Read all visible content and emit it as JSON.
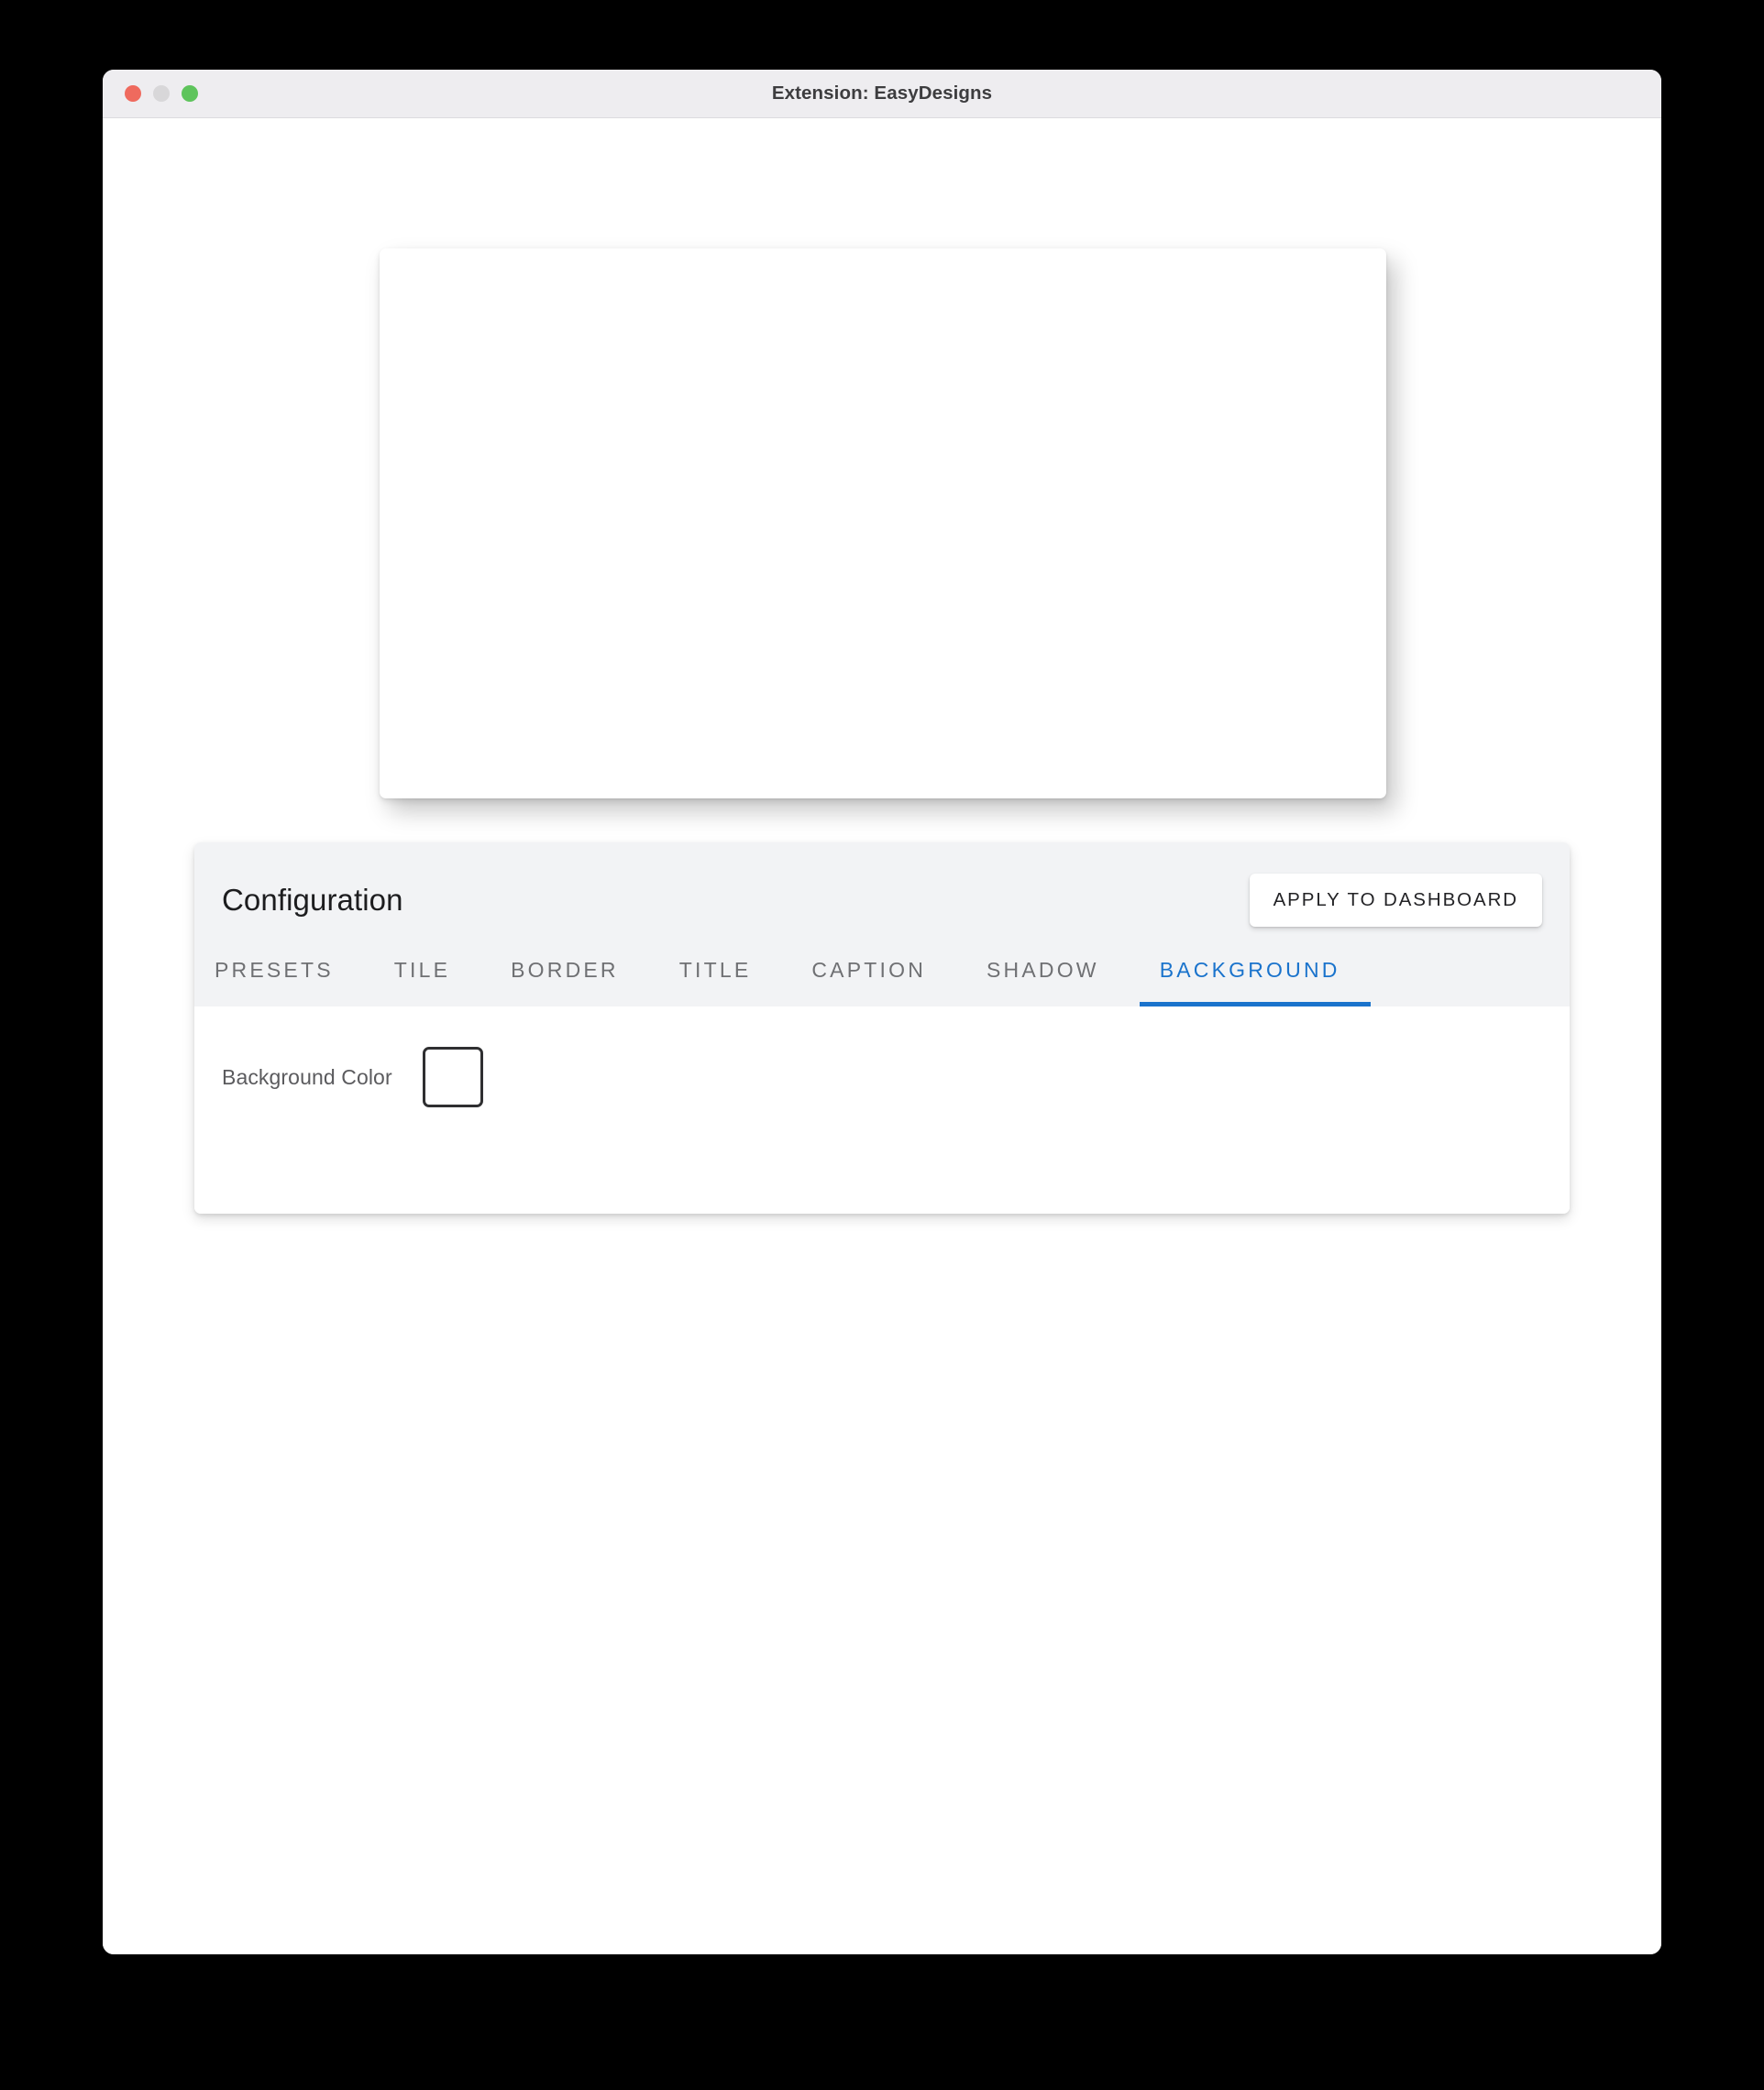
{
  "window": {
    "title": "Extension: EasyDesigns",
    "traffic_lights": [
      {
        "name": "close",
        "color": "#ef6a5e"
      },
      {
        "name": "minimize",
        "color": "#d8d7d9"
      },
      {
        "name": "zoom",
        "color": "#5ec45c"
      }
    ]
  },
  "preview": {
    "background_color": "#ffffff"
  },
  "configuration": {
    "title": "Configuration",
    "apply_button_label": "APPLY TO DASHBOARD",
    "active_tab": "BACKGROUND",
    "accent_color": "#1a73cc",
    "tabs": [
      {
        "label": "PRESETS",
        "active": false
      },
      {
        "label": "TILE",
        "active": false
      },
      {
        "label": "BORDER",
        "active": false
      },
      {
        "label": "TITLE",
        "active": false
      },
      {
        "label": "CAPTION",
        "active": false
      },
      {
        "label": "SHADOW",
        "active": false
      },
      {
        "label": "BACKGROUND",
        "active": true
      }
    ],
    "background_panel": {
      "color_label": "Background Color",
      "color_value": "#ffffff"
    }
  }
}
